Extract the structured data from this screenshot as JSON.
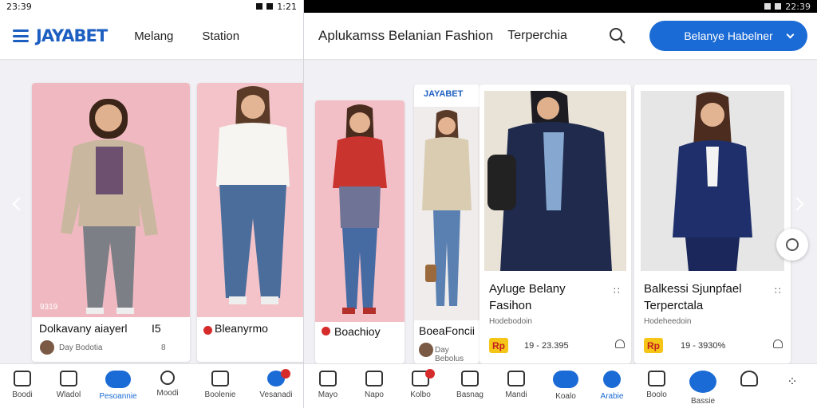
{
  "left": {
    "status": {
      "time": "23:39",
      "battery": "1:21"
    },
    "appbar": {
      "logo": "JAYABET",
      "nav1": "Melang",
      "nav2": "Station"
    },
    "cards": [
      {
        "caption": "Dolkavany aiayerl",
        "side_label": "I5",
        "seller": "Day Bodotia",
        "count": "8",
        "badge": "9319"
      },
      {
        "caption": "Bleanyrmo"
      }
    ]
  },
  "right": {
    "status": {
      "time": "22:39"
    },
    "appbar": {
      "title": "Aplukamss Belanian Fashion",
      "subtitle": "Terperchia",
      "cta": "Belanye Habelner"
    },
    "cards": [
      {
        "caption": "Boachioy"
      },
      {
        "logo": "JAYABET",
        "caption": "BoeaFoncii",
        "seller": "Day Bebolus"
      },
      {
        "caption": "Ayluge Belany Fasihon",
        "seller": "Hodebodoin",
        "price_tag": "Rp",
        "price": "19 - 23.395"
      },
      {
        "caption": "Balkessi Sjunpfael Terperctala",
        "seller": "Hodeheedoin",
        "price_tag": "Rp",
        "price": "19 - 3930%"
      }
    ]
  },
  "tabs": {
    "left": [
      "Boodi",
      "Wladol",
      "Pesoannie",
      "Moodi",
      "Boolenie",
      "Vesanadi"
    ],
    "right": [
      "Mayo",
      "Napo",
      "Kolbo",
      "Basnag",
      "Mandi",
      "Koalo",
      "Arabie",
      "Boolo",
      "Bassie"
    ]
  },
  "colors": {
    "accent": "#1b6bd6",
    "logo": "#1d5fc1",
    "badge": "#d62b2b",
    "price_tag": "#f5c518"
  },
  "icons": [
    "menu-icon",
    "search-icon",
    "chevron-down-icon",
    "back-arrow-icon",
    "next-arrow-icon",
    "history-icon",
    "bell-icon",
    "more-icon",
    "home-icon"
  ]
}
